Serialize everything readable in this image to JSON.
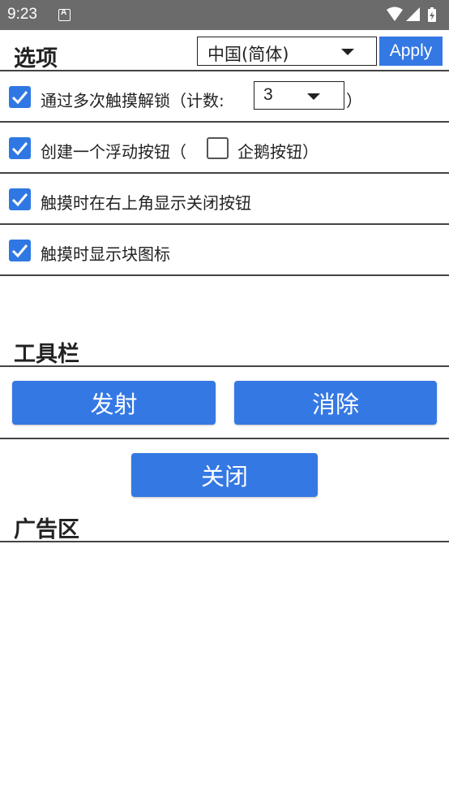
{
  "status_bar": {
    "time": "9:23",
    "icons": [
      "notification-a-icon",
      "wifi-icon",
      "signal-icon",
      "battery-icon"
    ]
  },
  "header": {
    "title": "选项",
    "language_select": {
      "value": "中国(简体)"
    },
    "apply_label": "Apply"
  },
  "options": {
    "multi_touch": {
      "checked": true,
      "label": "通过多次触摸解锁（计数:",
      "count_value": "3",
      "close_paren": "）"
    },
    "float_button": {
      "checked": true,
      "label_before": "创建一个浮动按钮（",
      "penguin_checked": false,
      "penguin_label": "企鹅按钮）"
    },
    "close_button": {
      "checked": true,
      "label": "触摸时在右上角显示关闭按钮"
    },
    "block_icon": {
      "checked": true,
      "label": "触摸时显示块图标"
    }
  },
  "toolbar": {
    "title": "工具栏",
    "launch_label": "发射",
    "clear_label": "消除",
    "close_label": "关闭"
  },
  "ad_area": {
    "title": "广告区"
  },
  "colors": {
    "accent": "#3478e4",
    "status_bar": "#6b6b6b",
    "divider": "#444444"
  }
}
